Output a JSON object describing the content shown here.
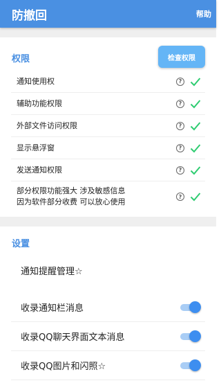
{
  "appbar": {
    "title": "防撤回",
    "help": "帮助"
  },
  "permissions": {
    "title": "权限",
    "check_button": "检查权限",
    "items": [
      {
        "label": "通知使用权",
        "granted": true
      },
      {
        "label": "辅助功能权限",
        "granted": true
      },
      {
        "label": "外部文件访问权限",
        "granted": true
      },
      {
        "label": "显示悬浮窗",
        "granted": true
      },
      {
        "label": "发送通知权限",
        "granted": true
      },
      {
        "label_line1": "部分权限功能强大 涉及敏感信息",
        "label_line2": "因为软件部分收费 可以放心使用",
        "granted": true
      }
    ],
    "help_glyph": "?"
  },
  "settings": {
    "title": "设置",
    "items": [
      {
        "label": "通知提醒管理☆"
      },
      {
        "label": "收录通知栏消息",
        "enabled": true
      },
      {
        "label": "收录QQ聊天界面文本消息",
        "enabled": true
      },
      {
        "label": "收录QQ图片和闪照☆",
        "enabled": true
      }
    ]
  },
  "colors": {
    "primary": "#4a90e2",
    "check": "#2ecc71",
    "switch_on": "#3d8ef0"
  }
}
